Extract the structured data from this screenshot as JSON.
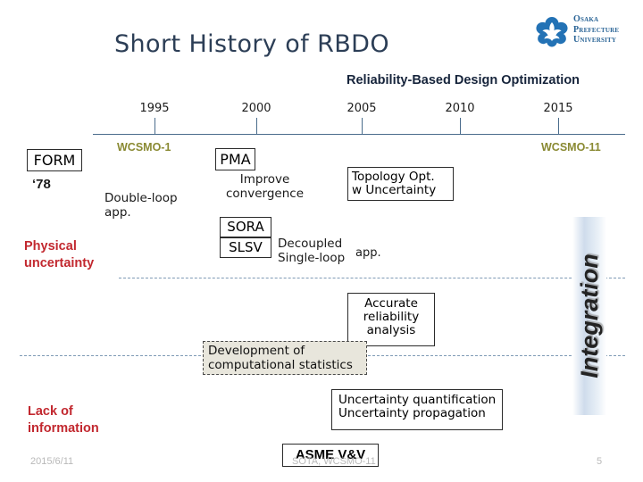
{
  "slide": {
    "title": "Short History of RBDO",
    "subtitle": "Reliability-Based Design Optimization"
  },
  "logo": {
    "line1": "Osaka",
    "line2": "Prefecture",
    "line3": "University",
    "mark": "ginkgo-emblem-icon",
    "color": "#2a6496"
  },
  "timeline": {
    "years": [
      "1995",
      "2000",
      "2005",
      "2010",
      "2015"
    ],
    "conferences": [
      {
        "label": "WCSMO-1",
        "color": "#8a8a33"
      },
      {
        "label": "WCSMO-11",
        "color": "#8a8a33"
      }
    ]
  },
  "nodes": {
    "form": "FORM",
    "form_year": "‘78",
    "double_loop_1": "Double-loop",
    "double_loop_2": "app.",
    "pma": "PMA",
    "improve_1": "Improve",
    "improve_2": "convergence",
    "topology_1": "Topology Opt.",
    "topology_2": "w Uncertainty",
    "sora": "SORA",
    "slsv": "SLSV",
    "decoupled_1": "Decoupled",
    "decoupled_2": "Single-loop",
    "app": "app.",
    "accurate_1": "Accurate",
    "accurate_2": "reliability",
    "accurate_3": "analysis",
    "devstats_1": "Development of",
    "devstats_2": "computational statistics",
    "uq_1": "Uncertainty quantification",
    "uq_2": "Uncertainty propagation",
    "asme": "ASME V&V"
  },
  "side_labels": {
    "physical_1": "Physical",
    "physical_2": "uncertainty",
    "lack_1": "Lack of",
    "lack_2": "information",
    "color": "#c2282f"
  },
  "integration": {
    "label": "Integration"
  },
  "footer": {
    "date": "2015/6/11",
    "middle": "SOTA, WCSMO-11",
    "page": "5"
  },
  "colors": {
    "title": "#2c3e56",
    "axis": "#4a6c8c",
    "conference": "#8a8a33",
    "red": "#c2282f",
    "devstats_bg": "#e8e6dc"
  }
}
